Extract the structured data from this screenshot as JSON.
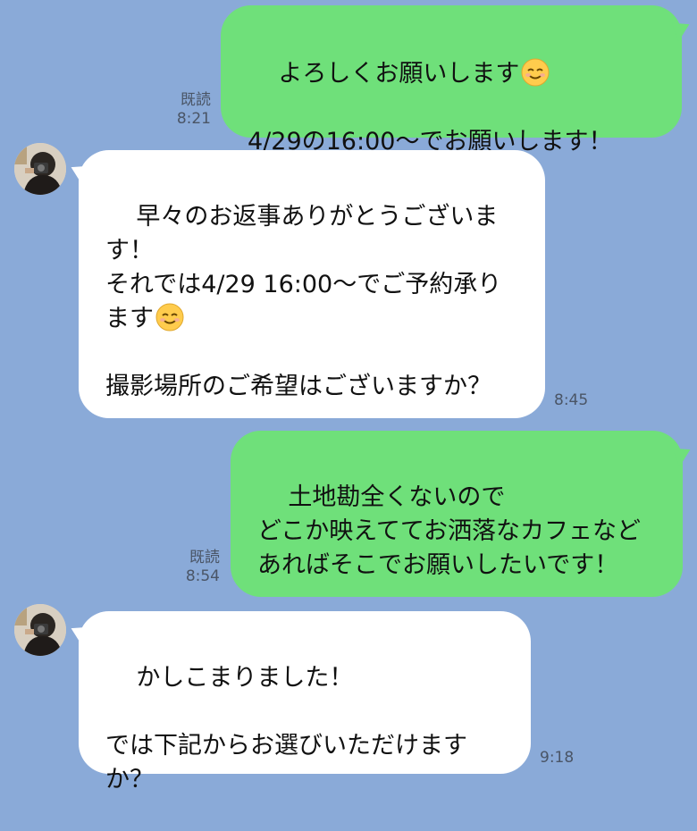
{
  "messages": [
    {
      "side": "out",
      "text": "よろしくお願いします",
      "emoji": "smiling-face-icon",
      "text2": "\n\n4/29の16:00〜でお願いします！",
      "read_label": "既読",
      "time": "8:21"
    },
    {
      "side": "in",
      "text": "早々のお返事ありがとうございます！\nそれでは4/29 16:00〜でご予約承ります",
      "emoji": "smiling-face-icon",
      "text2": "\n\n撮影場所のご希望はございますか？",
      "time": "8:45"
    },
    {
      "side": "out",
      "text": "土地勘全くないので\nどこか映えててお洒落なカフェなどあればそこでお願いしたいです！",
      "read_label": "既読",
      "time": "8:54"
    },
    {
      "side": "in",
      "text": "かしこまりました！\n\nでは下記からお選びいただけますか？",
      "time": "9:18"
    }
  ],
  "colors": {
    "background": "#8aaad8",
    "outgoing_bubble": "#6fe07a",
    "incoming_bubble": "#ffffff"
  }
}
